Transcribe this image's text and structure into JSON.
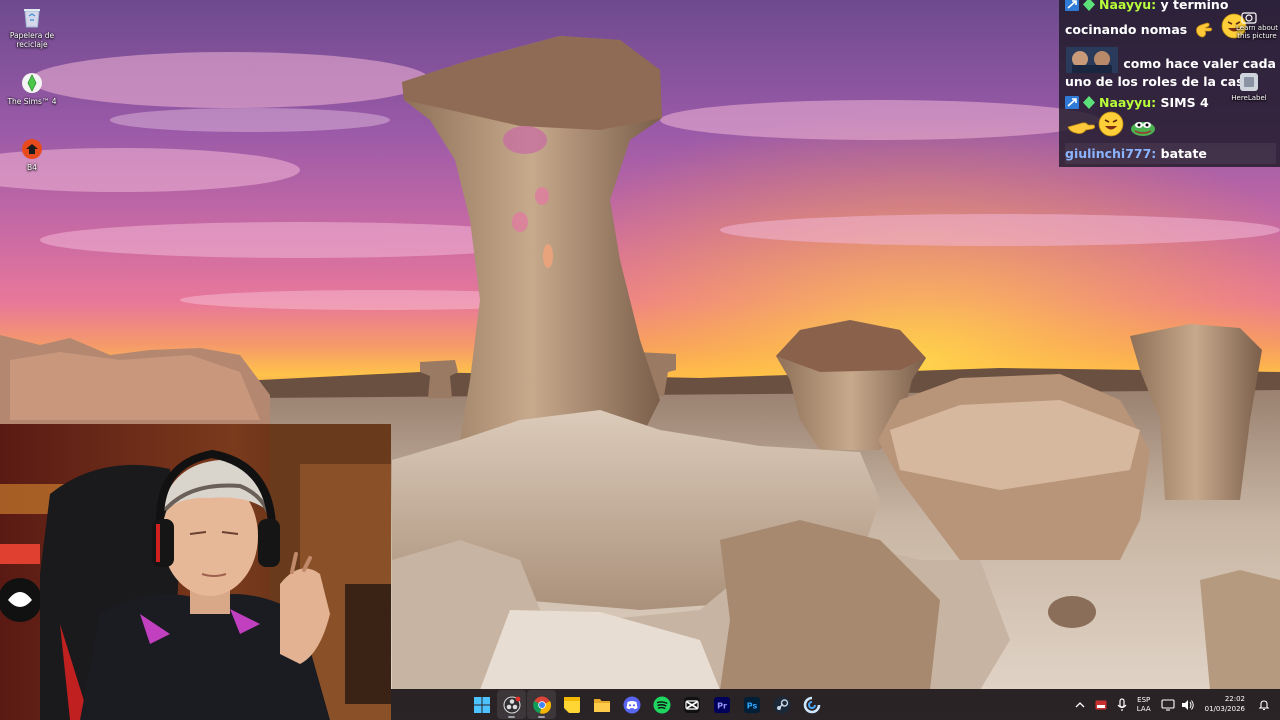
{
  "desktop": {
    "icons": [
      {
        "name": "recycle-bin-icon",
        "label": "Papelera de reciclaje"
      },
      {
        "name": "the-sims-4-icon",
        "label": "The Sims™ 4"
      },
      {
        "name": "b4-icon",
        "label": "B4"
      }
    ]
  },
  "chat": {
    "messages": [
      {
        "user": "Naayyu",
        "user_color": "#b8ff3a",
        "text": " y termino cocinando nomas"
      },
      {
        "user": "",
        "user_color": "#ffffff",
        "text": "como hace valer cada uno de los roles de la casa"
      },
      {
        "user": "Naayyu",
        "user_color": "#b8ff3a",
        "text": " SIMS 4"
      },
      {
        "user": "giulinchi777",
        "user_color": "#8ab4ff",
        "text": " batate"
      }
    ],
    "separator": ":"
  },
  "overlay_icons": {
    "learn_about_picture": "Learn about this picture",
    "here_label": "HereLabel"
  },
  "taskbar": {
    "apps": [
      "start-button",
      "obs-studio",
      "chrome",
      "sticky-notes",
      "file-explorer",
      "discord",
      "spotify",
      "capcut",
      "premiere-pro",
      "photoshop",
      "steam",
      "copilot"
    ],
    "language": {
      "line1": "ESP",
      "line2": "LAA"
    },
    "clock": {
      "time": "22:02",
      "date": "01/03/2026"
    }
  },
  "colors": {
    "taskbar": "#1c161a",
    "chat_bg": "#1e1a28",
    "accent_green": "#b8ff3a",
    "accent_blue": "#8ab4ff"
  }
}
